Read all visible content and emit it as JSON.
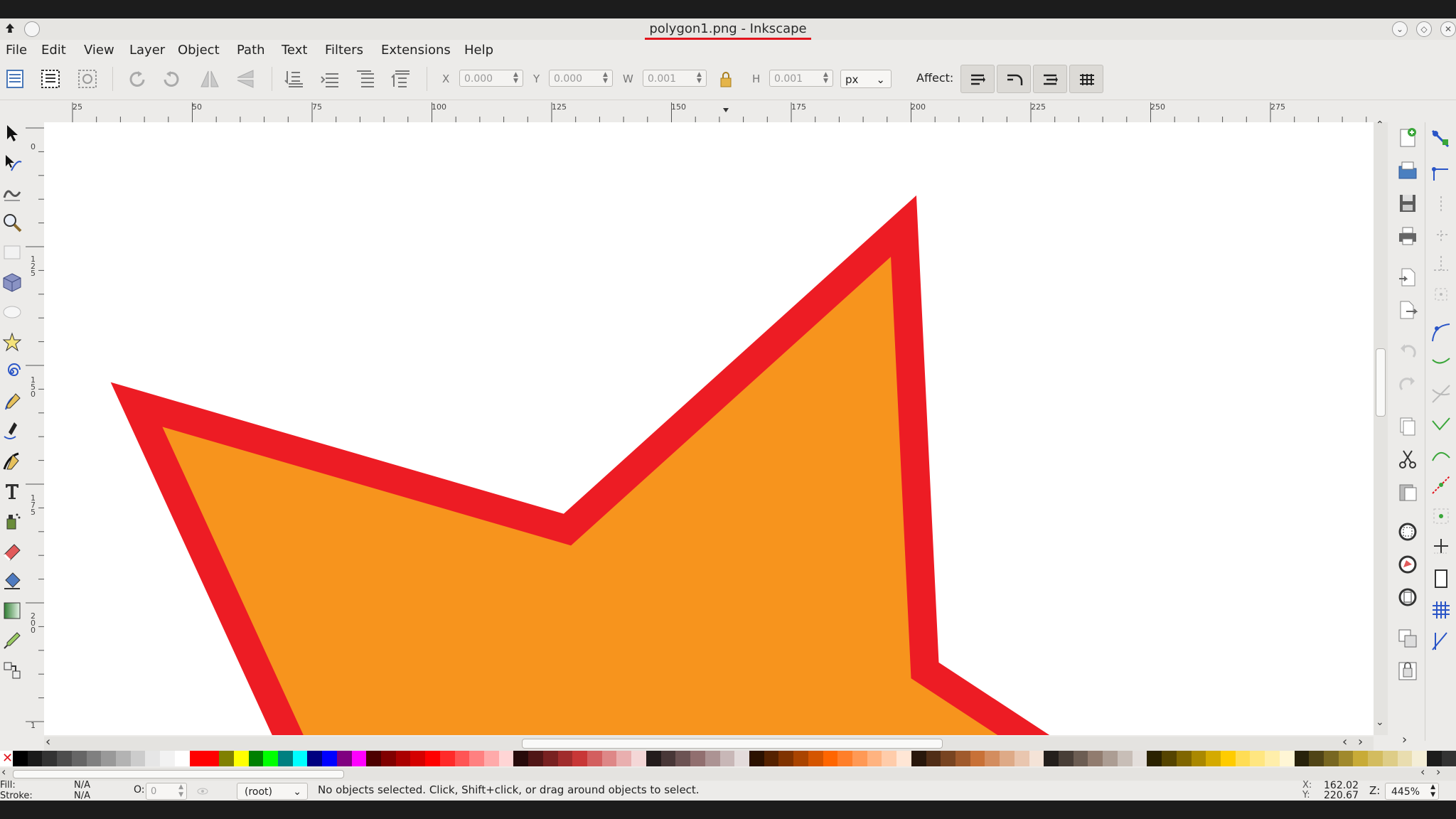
{
  "window": {
    "title": "polygon1.png - Inkscape"
  },
  "menu": [
    "File",
    "Edit",
    "View",
    "Layer",
    "Object",
    "Path",
    "Text",
    "Filters",
    "Extensions",
    "Help"
  ],
  "toolbar": {
    "x_label": "X",
    "x_value": "0.000",
    "y_label": "Y",
    "y_value": "0.000",
    "w_label": "W",
    "w_value": "0.001",
    "h_label": "H",
    "h_value": "0.001",
    "unit": "px",
    "affect_label": "Affect:"
  },
  "ruler": {
    "horizontal": [
      "25",
      "50",
      "75",
      "100",
      "125",
      "150",
      "175",
      "200",
      "225",
      "250",
      "275"
    ],
    "vertical": [
      "0",
      "1\n2\n5",
      "1\n5\n0",
      "1\n7\n5",
      "2\n0\n0",
      "1"
    ]
  },
  "canvas": {
    "fill_color": "#f7941d",
    "stroke_color": "#ed1c24"
  },
  "palette": [
    "#000000",
    "#1a1a1a",
    "#333333",
    "#4d4d4d",
    "#666666",
    "#808080",
    "#999999",
    "#b3b3b3",
    "#cccccc",
    "#e6e6e6",
    "#f2f2f2",
    "#ffffff",
    "#ff0000",
    "#ff0000",
    "#808000",
    "#ffff00",
    "#008000",
    "#00ff00",
    "#008080",
    "#00ffff",
    "#000080",
    "#0000ff",
    "#800080",
    "#ff00ff",
    "#4d0000",
    "#800000",
    "#aa0000",
    "#d40000",
    "#ff0000",
    "#ff2a2a",
    "#ff5555",
    "#ff8080",
    "#ffaaaa",
    "#ffd5d5",
    "#280b0b",
    "#501616",
    "#782121",
    "#a02c2c",
    "#c83737",
    "#d35f5f",
    "#de8787",
    "#e9afaf",
    "#f4d7d7",
    "#241c1c",
    "#483737",
    "#6c5353",
    "#916f6f",
    "#ac9393",
    "#c8b7b7",
    "#e3dbdb",
    "#2b1100",
    "#552200",
    "#803300",
    "#aa4400",
    "#d45500",
    "#ff6600",
    "#ff7f2a",
    "#ff9955",
    "#ffb380",
    "#ffccaa",
    "#ffe6d5",
    "#28170b",
    "#502d16",
    "#784421",
    "#a05a2c",
    "#c87137",
    "#d38d5f",
    "#deaa87",
    "#e9c6af",
    "#f4e3d7",
    "#241f1c",
    "#483e37",
    "#6c5d53",
    "#917c6f",
    "#ac9d93",
    "#c8beb7",
    "#e3dedb",
    "#2b2200",
    "#554400",
    "#806600",
    "#aa8800",
    "#d4aa00",
    "#ffcc00",
    "#ffdd55",
    "#ffe680",
    "#ffeeaa",
    "#fff6d5",
    "#28220b",
    "#504416",
    "#786721",
    "#a0892c",
    "#c8ab37",
    "#d3bc5f",
    "#decd87",
    "#e9ddaf",
    "#f4eed7",
    "#1c1c1c",
    "#333333"
  ],
  "status": {
    "fill_label": "Fill:",
    "fill_value": "N/A",
    "stroke_label": "Stroke:",
    "stroke_value": "N/A",
    "opacity_label": "O:",
    "opacity_value": "0",
    "layer": "(root)",
    "message": "No objects selected. Click, Shift+click, or drag around objects to select.",
    "x_label": "X:",
    "x_value": "162.02",
    "y_label": "Y:",
    "y_value": "220.67",
    "zoom_label": "Z:",
    "zoom_value": "445%"
  }
}
